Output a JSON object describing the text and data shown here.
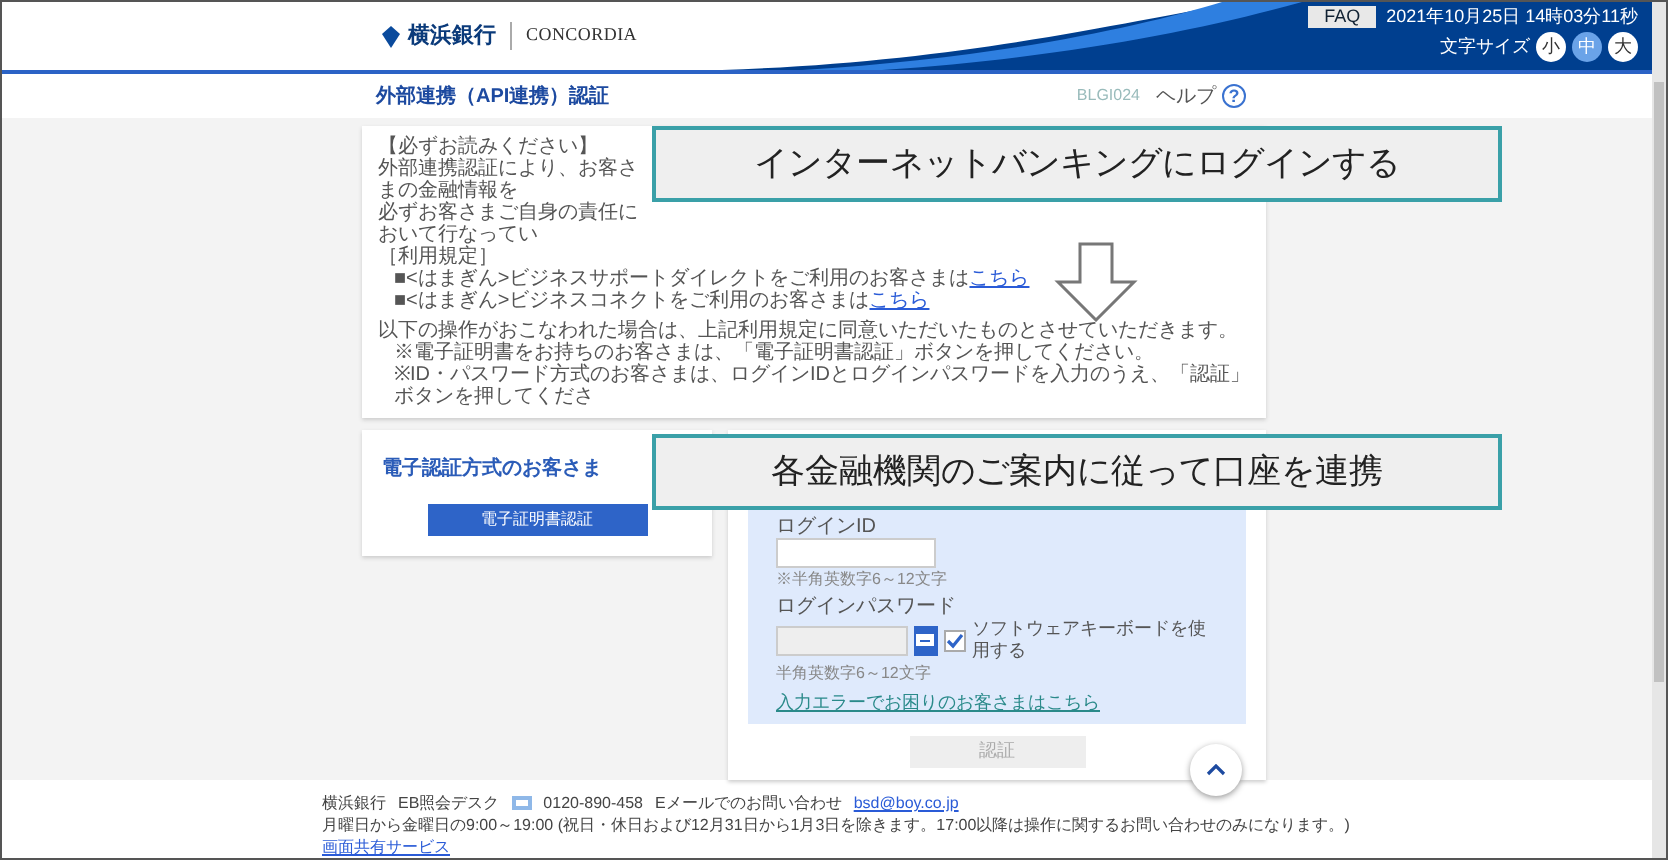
{
  "header": {
    "bank_name": "横浜銀行",
    "group_name": "CONCORDIA",
    "faq_button": "FAQ",
    "datetime": "2021年10月25日 14時03分11秒",
    "font_size_label": "文字サイズ",
    "font_sizes": [
      {
        "label": "小",
        "selected": false
      },
      {
        "label": "中",
        "selected": true
      },
      {
        "label": "大",
        "selected": false
      }
    ]
  },
  "title_bar": {
    "title": "外部連携（API連携）認証",
    "screen_id": "BLGI024",
    "help": "ヘルプ",
    "help_icon": "?"
  },
  "notice": {
    "heading": "【必ずお読みください】",
    "lines": [
      "外部連携認証により、お客さまの金融情報を",
      "必ずお客さまご自身の責任において行なってい"
    ],
    "terms_heading": "［利用規定］",
    "terms_links": [
      {
        "bullet": "■",
        "text": "<はまぎん>ビジネスサポートダイレクトをご利用のお客さまは",
        "link": "こちら"
      },
      {
        "bullet": "■",
        "text": "<はまぎん>ビジネスコネクトをご利用のお客さまは",
        "link": "こちら"
      }
    ],
    "consent": "以下の操作がおこなわれた場合は、上記利用規定に同意いただいたものとさせていただきます。",
    "instructions": [
      "※電子証明書をお持ちのお客さまは、「電子証明書認証」ボタンを押してください。",
      "※ID・パスワード方式のお客さまは、ログインIDとログインパスワードを入力のうえ、「認証」ボタンを押してくださ"
    ]
  },
  "callouts": [
    {
      "text": "インターネットバンキングにログインする"
    },
    {
      "text": "各金融機関のご案内に従って口座を連携"
    }
  ],
  "certificate_card": {
    "title": "電子認証方式のお客さま",
    "button": "電子証明書認証"
  },
  "login": {
    "id_label": "ログインID",
    "id_hint": "※半角英数字6～12文字",
    "password_label": "ログインパスワード",
    "password_hint": "半角英数字6～12文字",
    "software_keyboard": {
      "label": "ソフトウェアキーボードを使用する",
      "checked": true
    },
    "help_link": "入力エラーでお困りのお客さまはこちら",
    "submit": {
      "label": "認証",
      "disabled": true
    }
  },
  "footer": {
    "bank": "横浜銀行",
    "desk": "EB照会デスク",
    "phone": "0120-890-458",
    "email_label": "Eメールでのお問い合わせ",
    "email": "bsd@boy.co.jp",
    "hours": "月曜日から金曜日の9:00～19:00 (祝日・休日および12月31日から1月3日を除きます。17:00以降は操作に関するお問い合わせのみになります。)",
    "link": "画面共有サービス"
  }
}
